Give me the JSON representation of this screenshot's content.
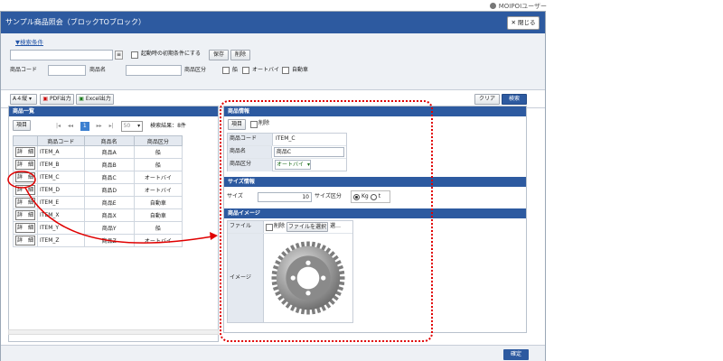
{
  "header": {
    "user": "MOIPOIユーザー"
  },
  "window": {
    "title": "サンプル商品照会（ブロックTOブロック）",
    "close_label": "✕ 閉じる"
  },
  "search": {
    "toggle_label": "▼検索条件",
    "keep_condition_label": "起動時の初期条件にする",
    "save_label": "保存",
    "delete_label": "削除",
    "code_label": "商品コード",
    "name_label": "商品名",
    "category_label": "商品区分",
    "categories": [
      "船",
      "オートバイ",
      "自動車"
    ]
  },
  "toolbar": {
    "paper": "A４縦",
    "pdf_label": "PDF出力",
    "excel_label": "Excel出力",
    "clear_label": "クリア",
    "search_label": "検索"
  },
  "list": {
    "title": "商品一覧",
    "item_button": "項目",
    "page": "1",
    "page_size": "50",
    "result_text": "検索結果：8件",
    "columns": [
      "",
      "商品コード",
      "商品名",
      "商品区分"
    ],
    "detail_label": "詳　細",
    "rows": [
      {
        "code": "ITEM_A",
        "name": "商品A",
        "category": "船"
      },
      {
        "code": "ITEM_B",
        "name": "商品B",
        "category": "船"
      },
      {
        "code": "ITEM_C",
        "name": "商品C",
        "category": "オートバイ"
      },
      {
        "code": "ITEM_D",
        "name": "商品D",
        "category": "オートバイ"
      },
      {
        "code": "ITEM_E",
        "name": "商品E",
        "category": "自動車"
      },
      {
        "code": "ITEM_X",
        "name": "商品X",
        "category": "自動車"
      },
      {
        "code": "ITEM_Y",
        "name": "商品Y",
        "category": "船"
      },
      {
        "code": "ITEM_Z",
        "name": "商品Z",
        "category": "オートバイ"
      }
    ]
  },
  "detail": {
    "title": "商品情報",
    "item_button": "項目",
    "delete_label": "削除",
    "code_label": "商品コード",
    "code_value": "ITEM_C",
    "name_label": "商品名",
    "name_value": "商品C",
    "category_label": "商品区分",
    "category_value": "オートバイ",
    "size_title": "サイズ情報",
    "size_label": "サイズ",
    "size_value": "10",
    "size_unit_label": "サイズ区分",
    "unit_options": [
      "Kg",
      "t"
    ],
    "image_title": "商品イメージ",
    "file_label": "ファイル",
    "file_delete_label": "削除",
    "file_button": "ファイルを選択",
    "file_status": "選…",
    "image_label": "イメージ"
  },
  "footer": {
    "confirm_label": "確定"
  },
  "colors": {
    "accent": "#2d5aa0",
    "highlight": "#e00000"
  }
}
